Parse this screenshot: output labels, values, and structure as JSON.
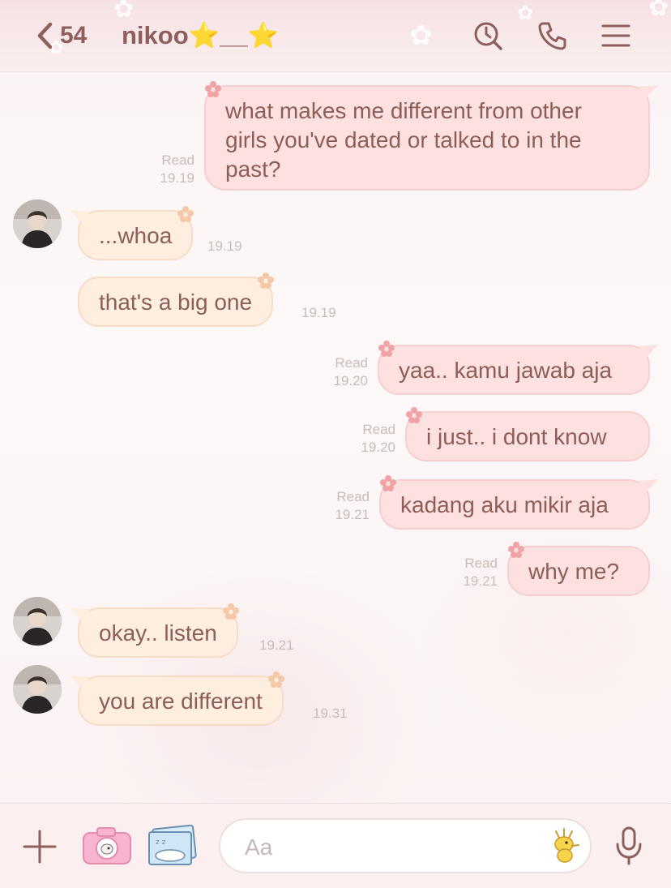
{
  "header": {
    "back_count": "54",
    "title": "nikoo⭐__⭐",
    "icons": [
      "back-chevron-icon",
      "search-history-icon",
      "phone-icon",
      "menu-icon"
    ]
  },
  "messages": [
    {
      "side": "out",
      "lines": [
        "what makes me different from other",
        "girls you've dated or talked to in the",
        "past?"
      ],
      "status": "Read",
      "time": "19.19"
    },
    {
      "side": "in",
      "text": "...whoa",
      "time": "19.19",
      "avatar": true
    },
    {
      "side": "in",
      "text": "that's a big one",
      "time": "19.19",
      "avatar": false
    },
    {
      "side": "out",
      "text": "yaa.. kamu jawab aja",
      "status": "Read",
      "time": "19.20"
    },
    {
      "side": "out",
      "text": "i just.. i dont know",
      "status": "Read",
      "time": "19.20"
    },
    {
      "side": "out",
      "text": "kadang aku mikir aja",
      "status": "Read",
      "time": "19.21"
    },
    {
      "side": "out",
      "text": "why me?",
      "status": "Read",
      "time": "19.21"
    },
    {
      "side": "in",
      "text": "okay.. listen",
      "time": "19.21",
      "avatar": true
    },
    {
      "side": "in",
      "text": "you are different",
      "time": "19.31",
      "avatar": true
    }
  ],
  "composer": {
    "placeholder": "Aa",
    "icons": [
      "plus-icon",
      "camera-icon",
      "photo-album-icon",
      "sticker-icon",
      "microphone-icon"
    ]
  },
  "colors": {
    "accent_text": "#8e5f5c",
    "outgoing_bubble": "#fde0e0",
    "incoming_bubble": "#fdeee0",
    "meta_text": "#c9bcb8"
  }
}
